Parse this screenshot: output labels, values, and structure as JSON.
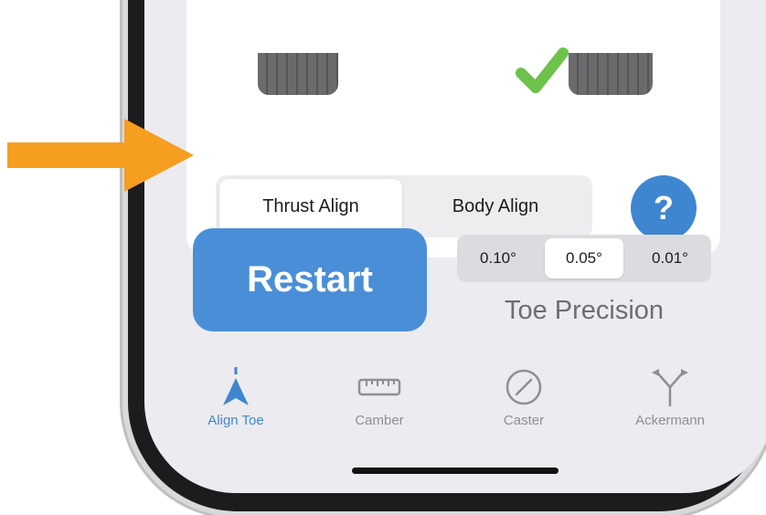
{
  "top_card": {
    "alignment_mode": {
      "options": [
        "Thrust Align",
        "Body Align"
      ],
      "selected": "Thrust Align"
    },
    "help_label": "?"
  },
  "controls": {
    "restart_label": "Restart",
    "precision": {
      "options": [
        "0.10°",
        "0.05°",
        "0.01°"
      ],
      "selected": "0.05°",
      "label": "Toe Precision"
    }
  },
  "tab_bar": {
    "tabs": [
      {
        "label": "Align Toe",
        "icon": "align-toe-icon",
        "active": true
      },
      {
        "label": "Camber",
        "icon": "ruler-icon",
        "active": false
      },
      {
        "label": "Caster",
        "icon": "caster-gauge-icon",
        "active": false
      },
      {
        "label": "Ackermann",
        "icon": "ackermann-icon",
        "active": false
      }
    ]
  },
  "colors": {
    "accent": "#3f86d0",
    "restart": "#4a8ed8",
    "check": "#6cc24a",
    "arrow": "#f59e1f"
  }
}
